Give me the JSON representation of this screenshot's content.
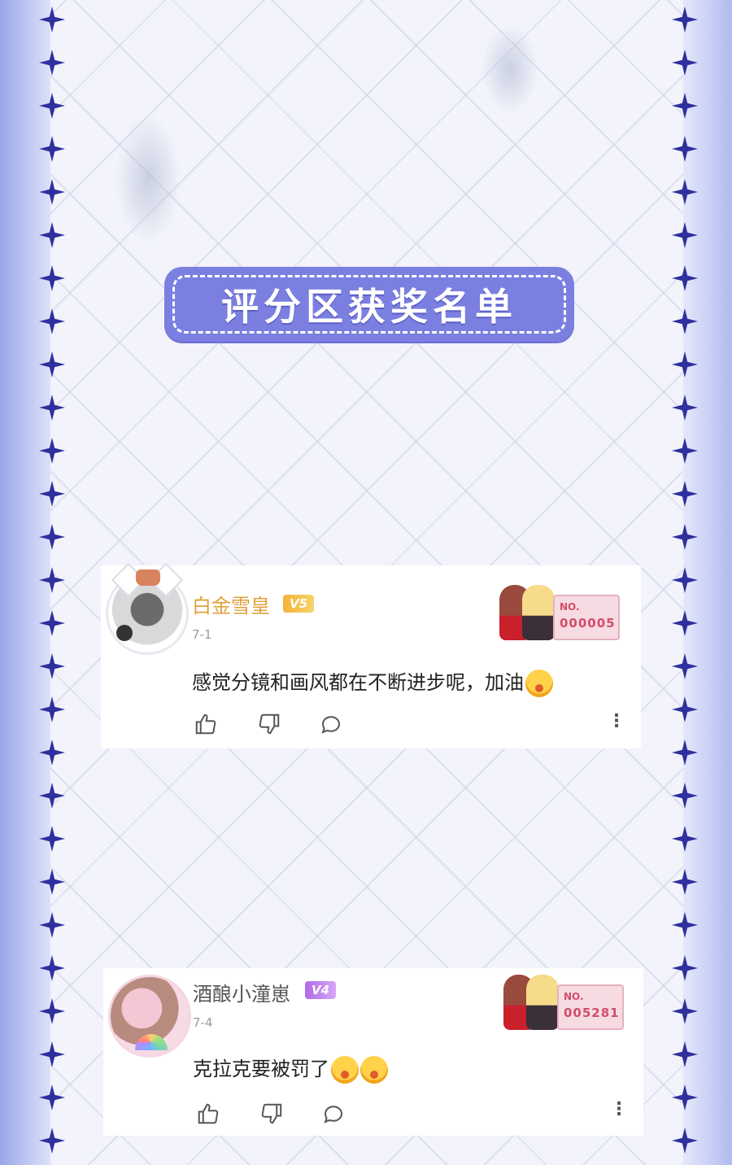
{
  "banner": {
    "title": "评分区获奖名单"
  },
  "comments": [
    {
      "username": "白金雪皇",
      "level": "V5",
      "date": "7-1",
      "text": "感觉分镜和画风都在不断进步呢，加油",
      "ticket_prefix": "NO.",
      "ticket_number": "000005"
    },
    {
      "username": "酒酿小潼崽",
      "level": "V4",
      "date": "7-4",
      "text": "克拉克要被罚了",
      "ticket_prefix": "NO.",
      "ticket_number": "005281"
    }
  ],
  "icons": {
    "like": "thumbs-up-icon",
    "dislike": "thumbs-down-icon",
    "reply": "comment-icon",
    "more": "more-vertical-icon"
  },
  "colors": {
    "banner": "#7b7fe0",
    "star": "#2f2f9e",
    "username_gold": "#e0a13a",
    "badge_v5": "#f4b338",
    "badge_v4": "#b06be8"
  }
}
